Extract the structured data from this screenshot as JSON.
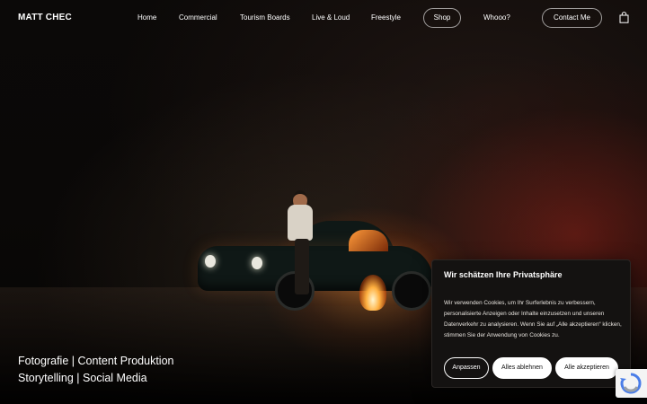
{
  "header": {
    "logo": "MATT CHEC",
    "nav": [
      {
        "label": "Home"
      },
      {
        "label": "Commercial"
      },
      {
        "label": "Tourism Boards"
      },
      {
        "label": "Live & Loud"
      },
      {
        "label": "Freestyle"
      },
      {
        "label": "Shop"
      },
      {
        "label": "Whooo?"
      },
      {
        "label": "Contact Me"
      }
    ],
    "cart_icon": "shopping-bag-icon"
  },
  "hero": {
    "line1": "Fotografie | Content Produktion",
    "line2": "Storytelling | Social Media"
  },
  "cookie_banner": {
    "title": "Wir schätzen Ihre Privatsphäre",
    "body": "Wir verwenden Cookies, um Ihr Surferlebnis zu verbessern, personalisierte Anzeigen oder Inhalte einzusetzen und unseren Datenverkehr zu analysieren. Wenn Sie auf „Alle akzeptieren“ klicken, stimmen Sie der Anwendung von Cookies zu.",
    "buttons": {
      "customize": "Anpassen",
      "reject": "Alles ablehnen",
      "accept": "Alle akzeptieren"
    }
  },
  "recaptcha_icon": "recaptcha-icon"
}
